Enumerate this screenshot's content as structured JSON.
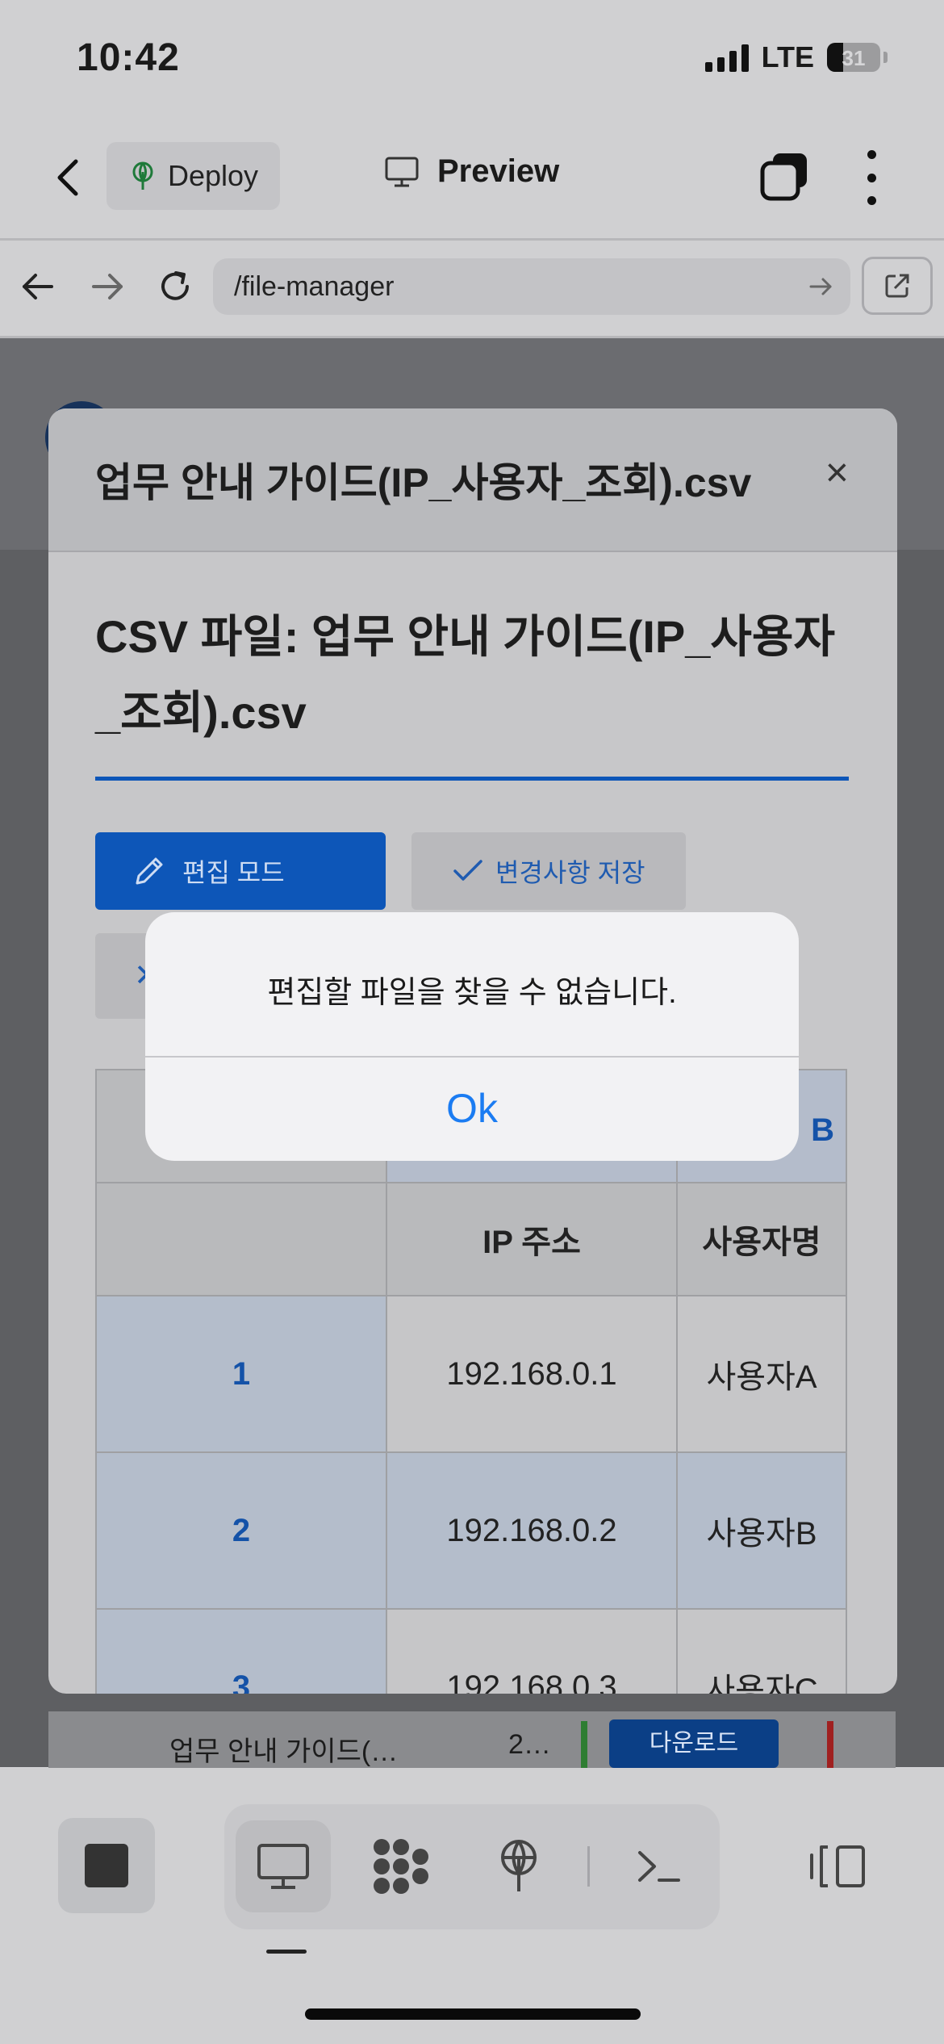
{
  "status_bar": {
    "time": "10:42",
    "network": "LTE",
    "battery": "31",
    "battery_level": 0.31
  },
  "app_bar": {
    "deploy_label": "Deploy",
    "title": "Preview"
  },
  "browser": {
    "url": "/file-manager"
  },
  "modal": {
    "header_title": "업무 안내 가이드(IP_사용자_조회).csv",
    "close": "×",
    "csv_title": "CSV 파일: 업무 안내 가이드(IP_사용자_조회).csv",
    "edit_mode_label": "편집 모드",
    "save_label": "변경사항 저장",
    "partial_button_glyph": "✕"
  },
  "table": {
    "col_letter_partial": "B",
    "headers": [
      "IP 주소",
      "사용자명"
    ],
    "rows": [
      {
        "num": "1",
        "ip": "192.168.0.1",
        "user": "사용자A"
      },
      {
        "num": "2",
        "ip": "192.168.0.2",
        "user": "사용자B"
      },
      {
        "num": "3",
        "ip": "192.168.0.3",
        "user": "사용자C"
      }
    ]
  },
  "alert": {
    "message": "편집할 파일을 찾을 수 없습니다.",
    "ok_label": "Ok"
  },
  "background_row": {
    "name": "업무 안내 가이드(…",
    "size": "2…",
    "download_label": "다운로드"
  },
  "toolbar": {
    "icons": [
      "stop-icon",
      "desktop-icon",
      "apps-icon",
      "deploy-icon",
      "terminal-icon",
      "panel-icon"
    ]
  },
  "colors": {
    "primary": "#0d56b8",
    "link_blue": "#1b7cf2",
    "dim_overlay": "#5e5f62"
  }
}
